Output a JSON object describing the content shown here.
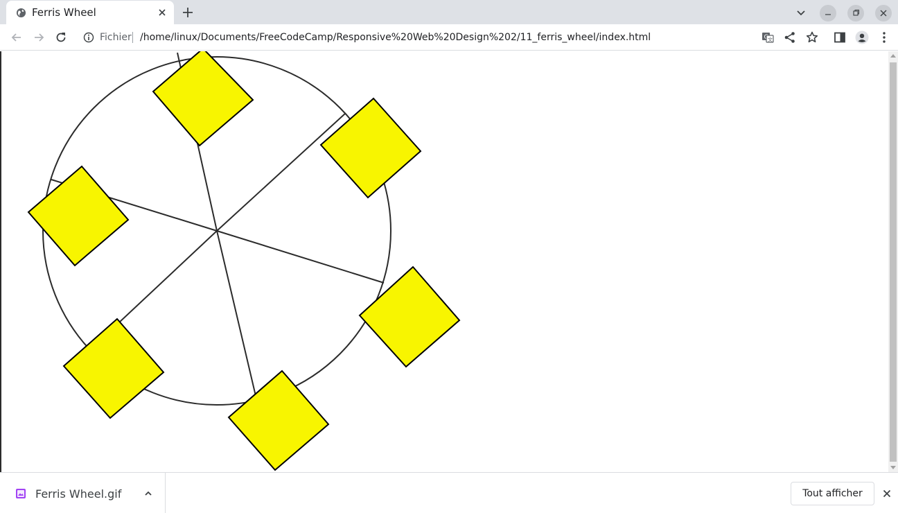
{
  "tab": {
    "title": "Ferris Wheel"
  },
  "omnibox": {
    "scheme_label": "Fichier",
    "url": "/home/linux/Documents/FreeCodeCamp/Responsive%20Web%20Design%202/11_ferris_wheel/index.html"
  },
  "page": {
    "wheel_color": "#2b2b2b",
    "cabin_color": "#f8f500",
    "cabin_count": 6,
    "line_count": 6
  },
  "download": {
    "file_name": "Ferris Wheel.gif",
    "show_all_label": "Tout afficher"
  },
  "icons": {
    "tab_favicon": "globe-icon",
    "tab_close": "close-icon",
    "new_tab": "plus-icon",
    "back": "arrow-left-icon",
    "forward": "arrow-right-icon",
    "reload": "reload-icon",
    "site_info": "info-icon",
    "translate": "translate-icon",
    "share": "share-icon",
    "bookmark": "star-icon",
    "side_panel": "side-panel-icon",
    "profile": "profile-icon",
    "menu": "kebab-menu-icon",
    "download_file": "image-file-icon"
  }
}
